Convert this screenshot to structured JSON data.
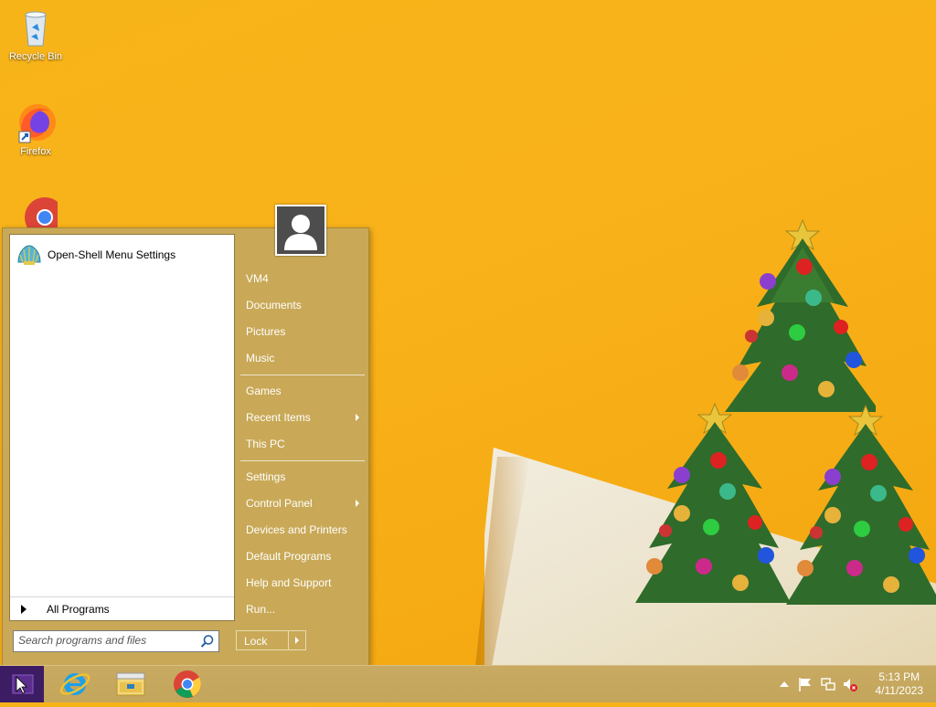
{
  "desktop": {
    "icons": [
      {
        "label": "Recycle Bin",
        "icon": "recycle-bin-icon"
      },
      {
        "label": "Firefox",
        "icon": "firefox-icon"
      },
      {
        "label": "",
        "icon": "chrome-icon"
      }
    ]
  },
  "start_menu": {
    "programs": [
      {
        "label": "Open-Shell Menu Settings",
        "icon": "open-shell-icon"
      }
    ],
    "all_programs_label": "All Programs",
    "search": {
      "placeholder": "Search programs and files",
      "value": ""
    },
    "right_items": {
      "user": "VM4",
      "documents": "Documents",
      "pictures": "Pictures",
      "music": "Music",
      "games": "Games",
      "recent_items": "Recent Items",
      "this_pc": "This PC",
      "settings": "Settings",
      "control_panel": "Control Panel",
      "devices_printers": "Devices and Printers",
      "default_programs": "Default Programs",
      "help_support": "Help and Support",
      "run": "Run..."
    },
    "lock_label": "Lock",
    "colors": {
      "menu_bg": "#c9a957",
      "taskbar_bg": "#c5a75e",
      "start_button": "#3c1c62"
    }
  },
  "taskbar": {
    "apps": [
      {
        "icon": "internet-explorer-icon"
      },
      {
        "icon": "file-explorer-icon"
      },
      {
        "icon": "chrome-icon"
      }
    ],
    "tray": {
      "icons": [
        "show-hidden-icons-icon",
        "action-center-flag-icon",
        "network-icon",
        "volume-muted-icon"
      ]
    },
    "clock": {
      "time": "5:13 PM",
      "date": "4/11/2023"
    }
  }
}
